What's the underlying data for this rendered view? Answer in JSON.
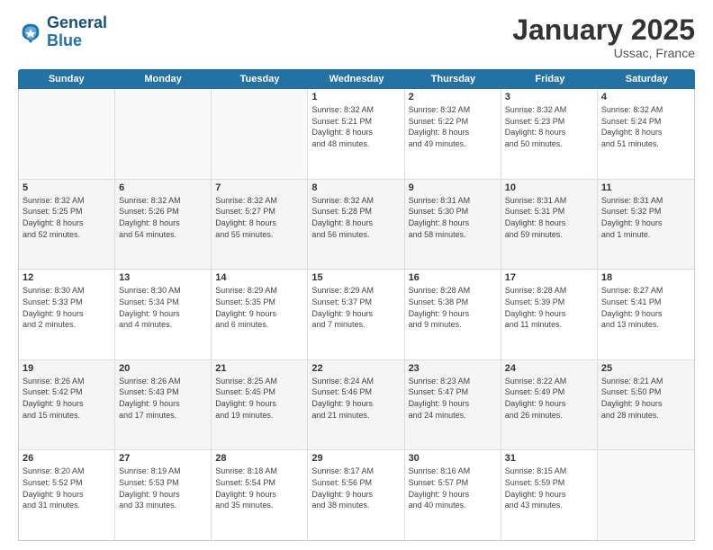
{
  "header": {
    "logo_general": "General",
    "logo_blue": "Blue",
    "month_title": "January 2025",
    "location": "Ussac, France"
  },
  "weekdays": [
    "Sunday",
    "Monday",
    "Tuesday",
    "Wednesday",
    "Thursday",
    "Friday",
    "Saturday"
  ],
  "rows": [
    [
      {
        "day": "",
        "detail": "",
        "empty": true
      },
      {
        "day": "",
        "detail": "",
        "empty": true
      },
      {
        "day": "",
        "detail": "",
        "empty": true
      },
      {
        "day": "1",
        "detail": "Sunrise: 8:32 AM\nSunset: 5:21 PM\nDaylight: 8 hours\nand 48 minutes."
      },
      {
        "day": "2",
        "detail": "Sunrise: 8:32 AM\nSunset: 5:22 PM\nDaylight: 8 hours\nand 49 minutes."
      },
      {
        "day": "3",
        "detail": "Sunrise: 8:32 AM\nSunset: 5:23 PM\nDaylight: 8 hours\nand 50 minutes."
      },
      {
        "day": "4",
        "detail": "Sunrise: 8:32 AM\nSunset: 5:24 PM\nDaylight: 8 hours\nand 51 minutes."
      }
    ],
    [
      {
        "day": "5",
        "detail": "Sunrise: 8:32 AM\nSunset: 5:25 PM\nDaylight: 8 hours\nand 52 minutes."
      },
      {
        "day": "6",
        "detail": "Sunrise: 8:32 AM\nSunset: 5:26 PM\nDaylight: 8 hours\nand 54 minutes."
      },
      {
        "day": "7",
        "detail": "Sunrise: 8:32 AM\nSunset: 5:27 PM\nDaylight: 8 hours\nand 55 minutes."
      },
      {
        "day": "8",
        "detail": "Sunrise: 8:32 AM\nSunset: 5:28 PM\nDaylight: 8 hours\nand 56 minutes."
      },
      {
        "day": "9",
        "detail": "Sunrise: 8:31 AM\nSunset: 5:30 PM\nDaylight: 8 hours\nand 58 minutes."
      },
      {
        "day": "10",
        "detail": "Sunrise: 8:31 AM\nSunset: 5:31 PM\nDaylight: 8 hours\nand 59 minutes."
      },
      {
        "day": "11",
        "detail": "Sunrise: 8:31 AM\nSunset: 5:32 PM\nDaylight: 9 hours\nand 1 minute."
      }
    ],
    [
      {
        "day": "12",
        "detail": "Sunrise: 8:30 AM\nSunset: 5:33 PM\nDaylight: 9 hours\nand 2 minutes."
      },
      {
        "day": "13",
        "detail": "Sunrise: 8:30 AM\nSunset: 5:34 PM\nDaylight: 9 hours\nand 4 minutes."
      },
      {
        "day": "14",
        "detail": "Sunrise: 8:29 AM\nSunset: 5:35 PM\nDaylight: 9 hours\nand 6 minutes."
      },
      {
        "day": "15",
        "detail": "Sunrise: 8:29 AM\nSunset: 5:37 PM\nDaylight: 9 hours\nand 7 minutes."
      },
      {
        "day": "16",
        "detail": "Sunrise: 8:28 AM\nSunset: 5:38 PM\nDaylight: 9 hours\nand 9 minutes."
      },
      {
        "day": "17",
        "detail": "Sunrise: 8:28 AM\nSunset: 5:39 PM\nDaylight: 9 hours\nand 11 minutes."
      },
      {
        "day": "18",
        "detail": "Sunrise: 8:27 AM\nSunset: 5:41 PM\nDaylight: 9 hours\nand 13 minutes."
      }
    ],
    [
      {
        "day": "19",
        "detail": "Sunrise: 8:26 AM\nSunset: 5:42 PM\nDaylight: 9 hours\nand 15 minutes."
      },
      {
        "day": "20",
        "detail": "Sunrise: 8:26 AM\nSunset: 5:43 PM\nDaylight: 9 hours\nand 17 minutes."
      },
      {
        "day": "21",
        "detail": "Sunrise: 8:25 AM\nSunset: 5:45 PM\nDaylight: 9 hours\nand 19 minutes."
      },
      {
        "day": "22",
        "detail": "Sunrise: 8:24 AM\nSunset: 5:46 PM\nDaylight: 9 hours\nand 21 minutes."
      },
      {
        "day": "23",
        "detail": "Sunrise: 8:23 AM\nSunset: 5:47 PM\nDaylight: 9 hours\nand 24 minutes."
      },
      {
        "day": "24",
        "detail": "Sunrise: 8:22 AM\nSunset: 5:49 PM\nDaylight: 9 hours\nand 26 minutes."
      },
      {
        "day": "25",
        "detail": "Sunrise: 8:21 AM\nSunset: 5:50 PM\nDaylight: 9 hours\nand 28 minutes."
      }
    ],
    [
      {
        "day": "26",
        "detail": "Sunrise: 8:20 AM\nSunset: 5:52 PM\nDaylight: 9 hours\nand 31 minutes."
      },
      {
        "day": "27",
        "detail": "Sunrise: 8:19 AM\nSunset: 5:53 PM\nDaylight: 9 hours\nand 33 minutes."
      },
      {
        "day": "28",
        "detail": "Sunrise: 8:18 AM\nSunset: 5:54 PM\nDaylight: 9 hours\nand 35 minutes."
      },
      {
        "day": "29",
        "detail": "Sunrise: 8:17 AM\nSunset: 5:56 PM\nDaylight: 9 hours\nand 38 minutes."
      },
      {
        "day": "30",
        "detail": "Sunrise: 8:16 AM\nSunset: 5:57 PM\nDaylight: 9 hours\nand 40 minutes."
      },
      {
        "day": "31",
        "detail": "Sunrise: 8:15 AM\nSunset: 5:59 PM\nDaylight: 9 hours\nand 43 minutes."
      },
      {
        "day": "",
        "detail": "",
        "empty": true
      }
    ]
  ]
}
